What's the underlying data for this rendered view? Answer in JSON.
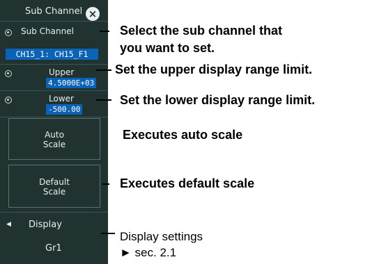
{
  "panel": {
    "title": "Sub Channel",
    "close_icon": "×",
    "sub_channel": {
      "label": "Sub Channel",
      "value": "CH15_1: CH15_F1"
    },
    "upper": {
      "label": "Upper",
      "value": "4.5000E+03"
    },
    "lower": {
      "label": "Lower",
      "value": "-500.00"
    },
    "auto_scale": {
      "line1": "Auto",
      "line2": "Scale"
    },
    "default_scale": {
      "line1": "Default",
      "line2": "Scale"
    },
    "display": {
      "arrow": "◀",
      "label": "Display",
      "value": "Gr1"
    }
  },
  "annotations": {
    "sub_channel": [
      "Select the sub channel that",
      "you want to set."
    ],
    "upper": "Set the upper display range limit.",
    "lower": "Set the lower display range limit.",
    "auto_scale": "Executes auto scale",
    "default_scale": "Executes default scale",
    "display": [
      "Display settings",
      "► sec. 2.1"
    ]
  },
  "colors": {
    "panel_bg": "#213331",
    "value_highlight": "#0b63b8"
  }
}
